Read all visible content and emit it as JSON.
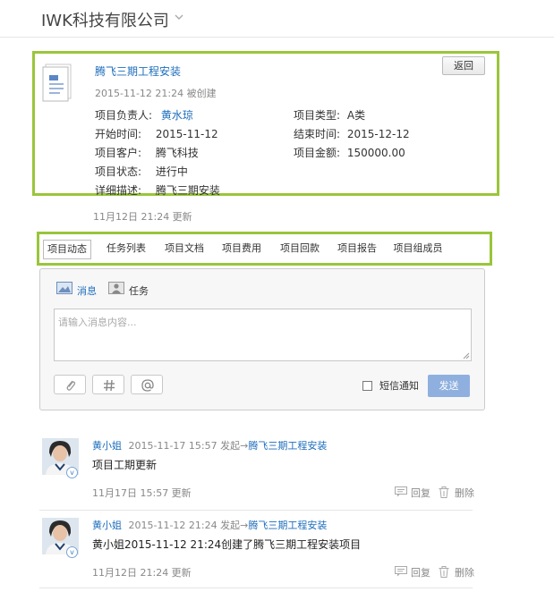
{
  "header": {
    "company": "IWK科技有限公司"
  },
  "project": {
    "title": "腾飞三期工程安装",
    "meta": "2015-11-12 21:24 被创建",
    "back_label": "返回",
    "fields": {
      "owner_label": "项目负责人:",
      "owner_value": "黄水琼",
      "type_label": "项目类型:",
      "type_value": "A类",
      "start_label": "开始时间:",
      "start_value": "2015-11-12",
      "end_label": "结束时间:",
      "end_value": "2015-12-12",
      "client_label": "项目客户:",
      "client_value": "腾飞科技",
      "amount_label": "项目金额:",
      "amount_value": "150000.00",
      "status_label": "项目状态:",
      "status_value": "进行中",
      "desc_label": "详细描述:",
      "desc_value": "腾飞三期安装"
    },
    "updated": "11月12日 21:24 更新"
  },
  "tabs": [
    "项目动态",
    "任务列表",
    "项目文档",
    "项目费用",
    "项目回款",
    "项目报告",
    "项目组成员"
  ],
  "composer": {
    "mode_message": "消息",
    "mode_task": "任务",
    "placeholder": "请输入消息内容...",
    "sms_label": "短信通知",
    "send_label": "发送"
  },
  "feed": [
    {
      "author": "黄小姐",
      "time": "2015-11-17 15:57 发起→",
      "project": "腾飞三期工程安装",
      "content": "项目工期更新",
      "updated": "11月17日 15:57 更新",
      "reply": "回复",
      "delete": "删除"
    },
    {
      "author": "黄小姐",
      "time": "2015-11-12 21:24 发起→",
      "project": "腾飞三期工程安装",
      "content": "黄小姐2015-11-12 21:24创建了腾飞三期工程安装项目",
      "updated": "11月12日 21:24 更新",
      "reply": "回复",
      "delete": "删除"
    }
  ],
  "colors": {
    "highlight": "#9ac53a",
    "link": "#1e6ebd",
    "send": "#8fb0df"
  }
}
